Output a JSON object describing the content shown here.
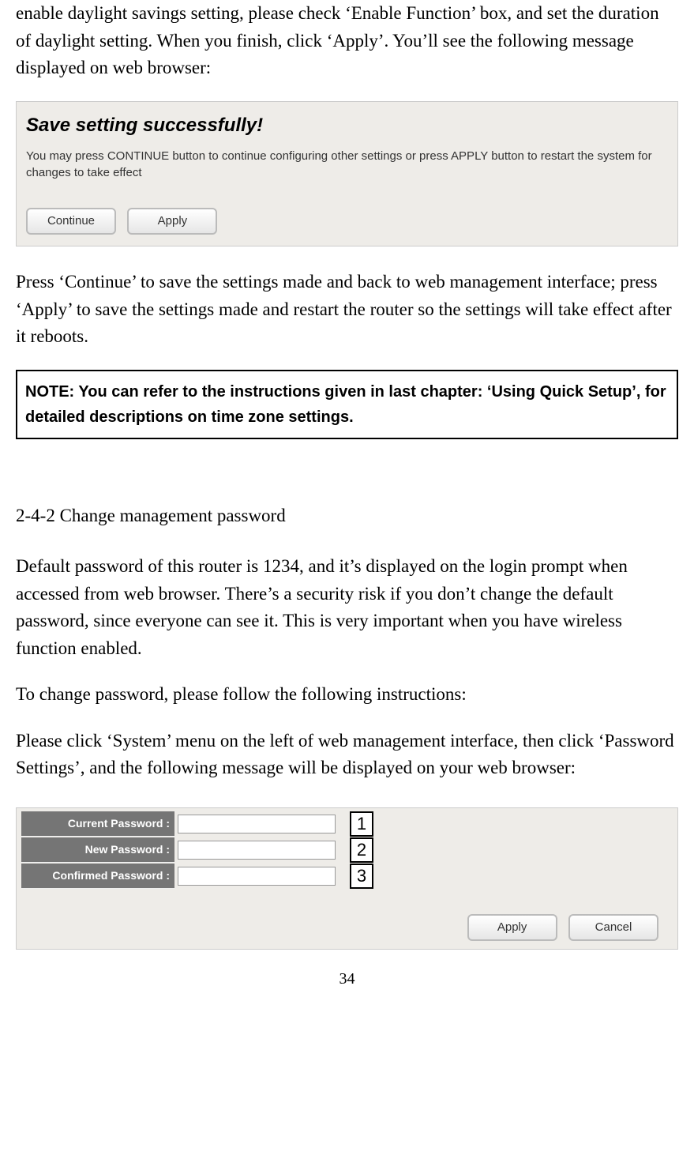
{
  "intro_para": "enable daylight savings setting, please check ‘Enable Function’ box, and set the duration of daylight setting. When you finish, click ‘Apply’. You’ll see the following message displayed on web browser:",
  "save_box": {
    "title": "Save setting successfully!",
    "message": "You may press CONTINUE button to continue configuring other settings or press APPLY button to restart the system for changes to take effect",
    "continue_label": "Continue",
    "apply_label": "Apply"
  },
  "after_save_para": "Press ‘Continue’ to save the settings made and back to web management interface; press ‘Apply’ to save the settings made and restart the router so the settings will take effect after it reboots.",
  "note_text": "NOTE: You can refer to the instructions given in last chapter: ‘Using Quick Setup’, for detailed descriptions on time zone settings.",
  "section_heading": "2-4-2 Change management password",
  "pwd_para1": "Default password of this router is 1234, and it’s displayed on the login prompt when accessed from web browser. There’s a security risk if you don’t change the default password, since everyone can see it. This is very important when you have wireless function enabled.",
  "pwd_para2": "To change password, please follow the following instructions:",
  "pwd_para3": "Please click ‘System’ menu on the left of web management interface, then click ‘Password Settings’, and the following message will be displayed on your web browser:",
  "pwd_form": {
    "rows": [
      {
        "label": "Current Password :",
        "callout": "1"
      },
      {
        "label": "New Password :",
        "callout": "2"
      },
      {
        "label": "Confirmed Password :",
        "callout": "3"
      }
    ],
    "apply_label": "Apply",
    "cancel_label": "Cancel"
  },
  "page_number": "34"
}
